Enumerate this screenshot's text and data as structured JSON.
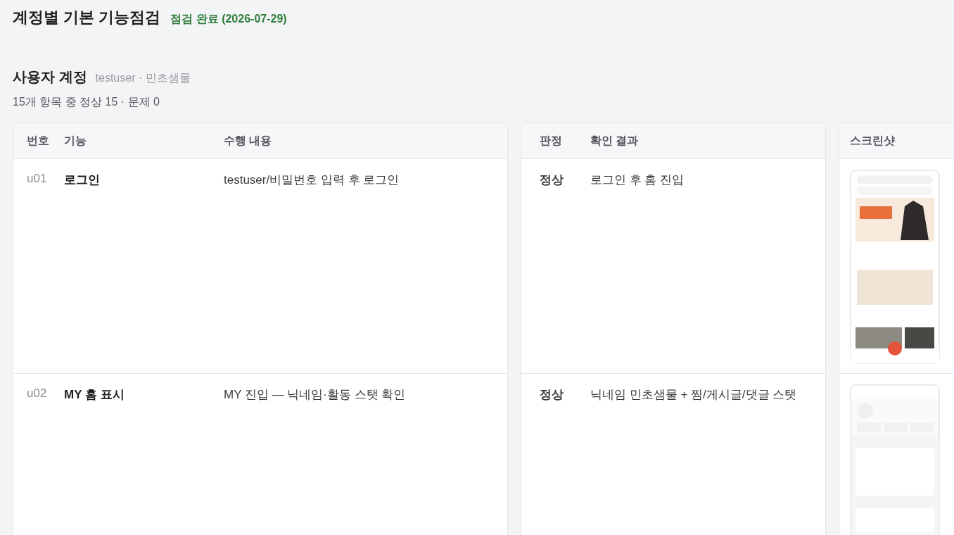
{
  "title": "계정별 기본 기능점검",
  "status": "점검 완료 (2026-07-29)",
  "section": {
    "title": "사용자 계정",
    "account": "testuser · 민초샘물",
    "summary": "15개 항목 중 정상 15 · 문제 0"
  },
  "table": {
    "columns": [
      "번호",
      "기능",
      "수행 내용",
      "판정",
      "확인 결과",
      "스크린샷"
    ],
    "rows": [
      {
        "id": "u01",
        "feature": "로그인",
        "action": "testuser/비밀번호 입력 후 로그인",
        "verdict": "정상",
        "result": "로그인 후 홈 진입"
      },
      {
        "id": "u02",
        "feature": "MY 홈 표시",
        "action": "MY 진입 — 닉네임·활동 스탯 확인",
        "verdict": "정상",
        "result": "닉네임 민초샘물 + 찜/게시글/댓글 스탯"
      }
    ]
  }
}
